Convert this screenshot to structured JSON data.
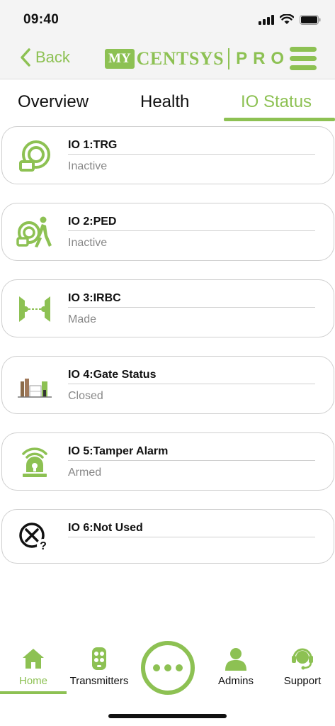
{
  "status_bar": {
    "time": "09:40"
  },
  "header": {
    "back_label": "Back",
    "logo": {
      "my": "MY",
      "centsys": "CENTSYS",
      "pro": "PRO"
    }
  },
  "tabs": [
    {
      "label": "Overview",
      "active": false
    },
    {
      "label": "Health",
      "active": false
    },
    {
      "label": "IO Status",
      "active": true
    }
  ],
  "io_items": [
    {
      "title": "IO 1:TRG",
      "status": "Inactive",
      "icon": "trigger-icon"
    },
    {
      "title": "IO 2:PED",
      "status": "Inactive",
      "icon": "pedestrian-icon"
    },
    {
      "title": "IO 3:IRBC",
      "status": "Made",
      "icon": "infrared-beam-icon"
    },
    {
      "title": "IO 4:Gate Status",
      "status": "Closed",
      "icon": "gate-icon"
    },
    {
      "title": "IO 5:Tamper Alarm",
      "status": "Armed",
      "icon": "alarm-beacon-icon"
    },
    {
      "title": "IO 6:Not Used",
      "status": "",
      "icon": "not-used-icon"
    }
  ],
  "bottom_nav": [
    {
      "label": "Home",
      "icon": "home-icon",
      "active": true
    },
    {
      "label": "Transmitters",
      "icon": "remote-icon",
      "active": false
    },
    {
      "label": "Admins",
      "icon": "user-icon",
      "active": false
    },
    {
      "label": "Support",
      "icon": "headset-icon",
      "active": false
    }
  ],
  "colors": {
    "accent": "#8dc153",
    "text": "#111111",
    "muted": "#888888",
    "border": "#cfcfcf",
    "header_bg": "#f4f4f4"
  }
}
